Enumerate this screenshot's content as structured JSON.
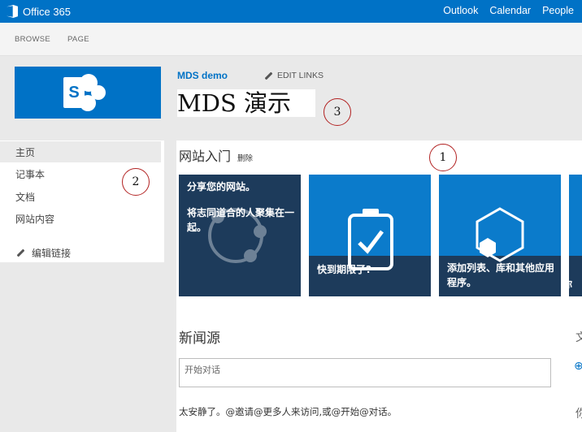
{
  "suite_bar": {
    "brand": "Office 365",
    "links": [
      "Outlook",
      "Calendar",
      "People"
    ]
  },
  "ribbon": {
    "tabs": [
      "BROWSE",
      "PAGE"
    ]
  },
  "site": {
    "breadcrumb": "MDS demo",
    "edit_links": "EDIT LINKS",
    "title": "MDS 演示",
    "logo_letter": "S"
  },
  "callouts": [
    "1",
    "2",
    "3"
  ],
  "left_nav": {
    "items": [
      "主页",
      "记事本",
      "文档",
      "网站内容"
    ],
    "edit_links": "编辑链接"
  },
  "get_started": {
    "title": "网站入门",
    "remove": "删除",
    "tiles": [
      {
        "title": "分享您的网站。",
        "body": "将志同道合的人聚集在一起。"
      },
      {
        "title": "快到期限了?"
      },
      {
        "title": "添加列表、库和其他应用程序。"
      },
      {
        "title": "你"
      }
    ]
  },
  "newsfeed": {
    "title": "新闻源",
    "input_placeholder": "开始对话",
    "empty_message": "太安静了。@邀请@更多人来访问,或@开始@对话。"
  },
  "right_peek": [
    "文",
    "⊕",
    "你"
  ],
  "colors": {
    "suite_blue": "#0072c6",
    "tile_dark": "#1d3b5b",
    "tile_blue": "#0b7bcb",
    "callout_red": "#b22222"
  }
}
